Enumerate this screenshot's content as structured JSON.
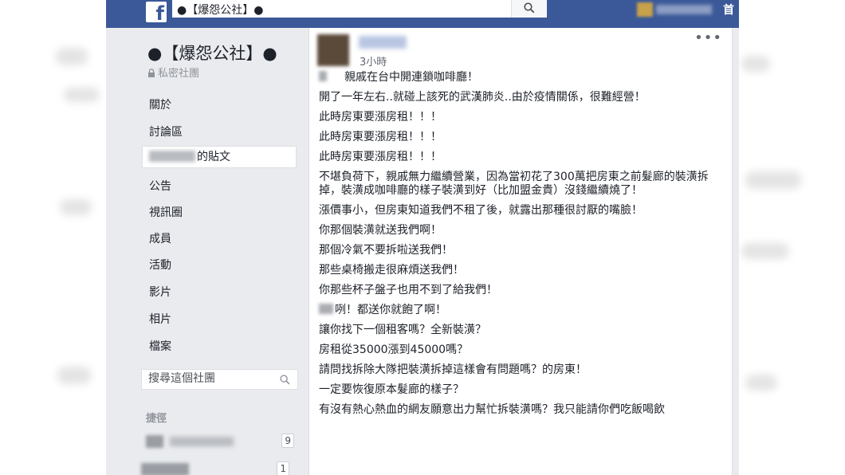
{
  "topbar": {
    "search_value": "●【爆怨公社】●",
    "home_label": "首"
  },
  "sidebar": {
    "group_name": "●【爆怨公社】●",
    "privacy_label": "私密社團",
    "nav": [
      {
        "label": "關於"
      },
      {
        "label": "討論區"
      },
      {
        "label": "的貼文"
      },
      {
        "label": "公告"
      },
      {
        "label": "視訊圈"
      },
      {
        "label": "成員"
      },
      {
        "label": "活動"
      },
      {
        "label": "影片"
      },
      {
        "label": "相片"
      },
      {
        "label": "檔案"
      }
    ],
    "search_placeholder": "搜尋這個社團",
    "shortcuts_heading": "捷徑",
    "shortcuts": [
      {
        "count": "9"
      },
      {
        "count": "1"
      }
    ]
  },
  "post": {
    "time": "3小時",
    "lines": [
      "親戚在台中開連鎖咖啡廳！",
      "開了一年左右..就碰上該死的武漢肺炎..由於疫情關係，很難經營！",
      "此時房東要漲房租！！！",
      "此時房東要漲房租！！！",
      "此時房東要漲房租！！！",
      "不堪負荷下，親戚無力繼續營業，因為當初花了300萬把房東之前髮廊的裝潢拆掉，裝潢成咖啡廳的樣子裝潢到好（比加盟金貴）沒錢繼續燒了！",
      "漲價事小，但房東知道我們不租了後，就露出那種很討厭的嘴臉！",
      "你那個裝潢就送我們啊！",
      "那個冷氣不要拆啦送我們！",
      "那些桌椅搬走很麻煩送我們！",
      "你那些杯子盤子也用不到了給我們！",
      "咧！都送你就飽了啊！",
      "讓你找下一個租客嗎？全新裝潢？",
      "房租從35000漲到45000嗎？",
      "請問找拆除大隊把裝潢拆掉這樣會有問題嗎？的房東！",
      "一定要恢復原本髮廊的樣子？",
      "有沒有熱心熱血的網友願意出力幫忙拆裝潢嗎？我只能請你們吃飯喝飲"
    ]
  }
}
